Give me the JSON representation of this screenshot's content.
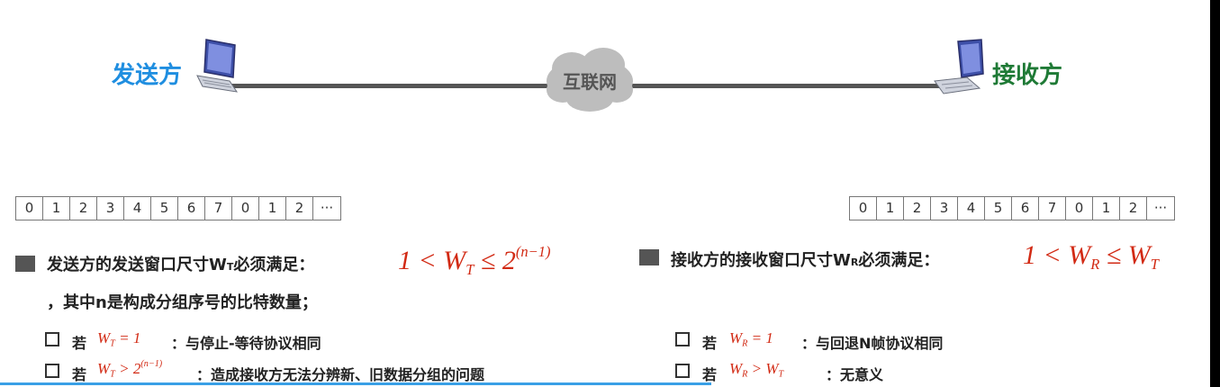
{
  "diagram": {
    "sender_label": "发送方",
    "receiver_label": "接收方",
    "network_label": "互联网"
  },
  "sequence": {
    "cells": [
      "0",
      "1",
      "2",
      "3",
      "4",
      "5",
      "6",
      "7",
      "0",
      "1",
      "2",
      "···"
    ]
  },
  "sender_condition": {
    "text": "发送方的发送窗口尺寸W",
    "sub": "T",
    "text_suffix": "必须满足：",
    "formula_left": "1 < W",
    "formula_sub": "T",
    "formula_mid": " ≤ 2",
    "formula_sup": "(n−1)",
    "note": "，其中n是构成分组序号的比特数量；"
  },
  "receiver_condition": {
    "text": "接收方的接收窗口尺寸W",
    "sub": "R",
    "text_suffix": "必须满足：",
    "formula_left": "1 < W",
    "formula_sub": "R",
    "formula_mid": " ≤ W",
    "formula_sub2": "T"
  },
  "sender_cases": [
    {
      "prefix": "若",
      "f_main": "W",
      "f_sub": "T",
      "f_rest": " = 1",
      "desc": "：与停止-等待协议相同"
    },
    {
      "prefix": "若",
      "f_main": "W",
      "f_sub": "T",
      "f_rest": " > 2",
      "f_sup": "(n−1)",
      "desc": "：造成接收方无法分辨新、旧数据分组的问题"
    }
  ],
  "receiver_cases": [
    {
      "prefix": "若",
      "f_main": "W",
      "f_sub": "R",
      "f_rest": " = 1",
      "desc": "：与回退N帧协议相同"
    },
    {
      "prefix": "若",
      "f_main": "W",
      "f_sub": "R",
      "f_rest": " > W",
      "f_sub2": "T",
      "desc": "：无意义"
    }
  ],
  "colors": {
    "sender_blue": "#1f8ee0",
    "receiver_green": "#1f7a36",
    "formula_red": "#d22a14"
  }
}
